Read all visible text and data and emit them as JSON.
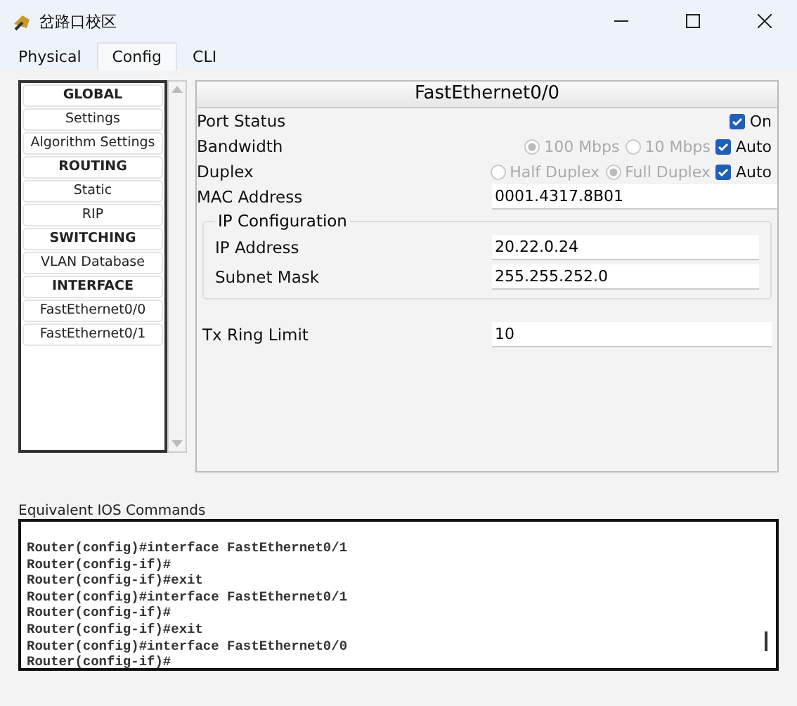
{
  "window": {
    "title": "岔路口校区"
  },
  "tabs": [
    {
      "label": "Physical",
      "selected": false
    },
    {
      "label": "Config",
      "selected": true
    },
    {
      "label": "CLI",
      "selected": false
    }
  ],
  "sidebar": {
    "items": [
      {
        "kind": "header",
        "label": "GLOBAL"
      },
      {
        "kind": "item",
        "label": "Settings"
      },
      {
        "kind": "item",
        "label": "Algorithm Settings"
      },
      {
        "kind": "header",
        "label": "ROUTING"
      },
      {
        "kind": "item",
        "label": "Static"
      },
      {
        "kind": "item",
        "label": "RIP"
      },
      {
        "kind": "header",
        "label": "SWITCHING"
      },
      {
        "kind": "item",
        "label": "VLAN Database"
      },
      {
        "kind": "header",
        "label": "INTERFACE"
      },
      {
        "kind": "item",
        "label": "FastEthernet0/0"
      },
      {
        "kind": "item",
        "label": "FastEthernet0/1"
      }
    ]
  },
  "interface": {
    "title": "FastEthernet0/0",
    "port_status": {
      "label": "Port Status",
      "checkbox": {
        "label": "On",
        "checked": true
      }
    },
    "bandwidth": {
      "label": "Bandwidth",
      "options": [
        {
          "label": "100 Mbps",
          "selected": true
        },
        {
          "label": "10 Mbps",
          "selected": false
        }
      ],
      "auto": {
        "label": "Auto",
        "checked": true
      }
    },
    "duplex": {
      "label": "Duplex",
      "options": [
        {
          "label": "Half Duplex",
          "selected": false
        },
        {
          "label": "Full Duplex",
          "selected": true
        }
      ],
      "auto": {
        "label": "Auto",
        "checked": true
      }
    },
    "mac": {
      "label": "MAC Address",
      "value": "0001.4317.8B01"
    },
    "ip_configuration": {
      "title": "IP Configuration",
      "fields": [
        {
          "label": "IP Address",
          "value": "20.22.0.24"
        },
        {
          "label": "Subnet Mask",
          "value": "255.255.252.0"
        }
      ]
    },
    "tx_ring_limit": {
      "label": "Tx Ring Limit",
      "value": "10"
    }
  },
  "ios_commands": {
    "label": "Equivalent IOS Commands",
    "lines": [
      "Router(config)#interface FastEthernet0/1",
      "Router(config-if)#",
      "Router(config-if)#exit",
      "Router(config)#interface FastEthernet0/1",
      "Router(config-if)#",
      "Router(config-if)#exit",
      "Router(config)#interface FastEthernet0/0",
      "Router(config-if)#"
    ]
  }
}
